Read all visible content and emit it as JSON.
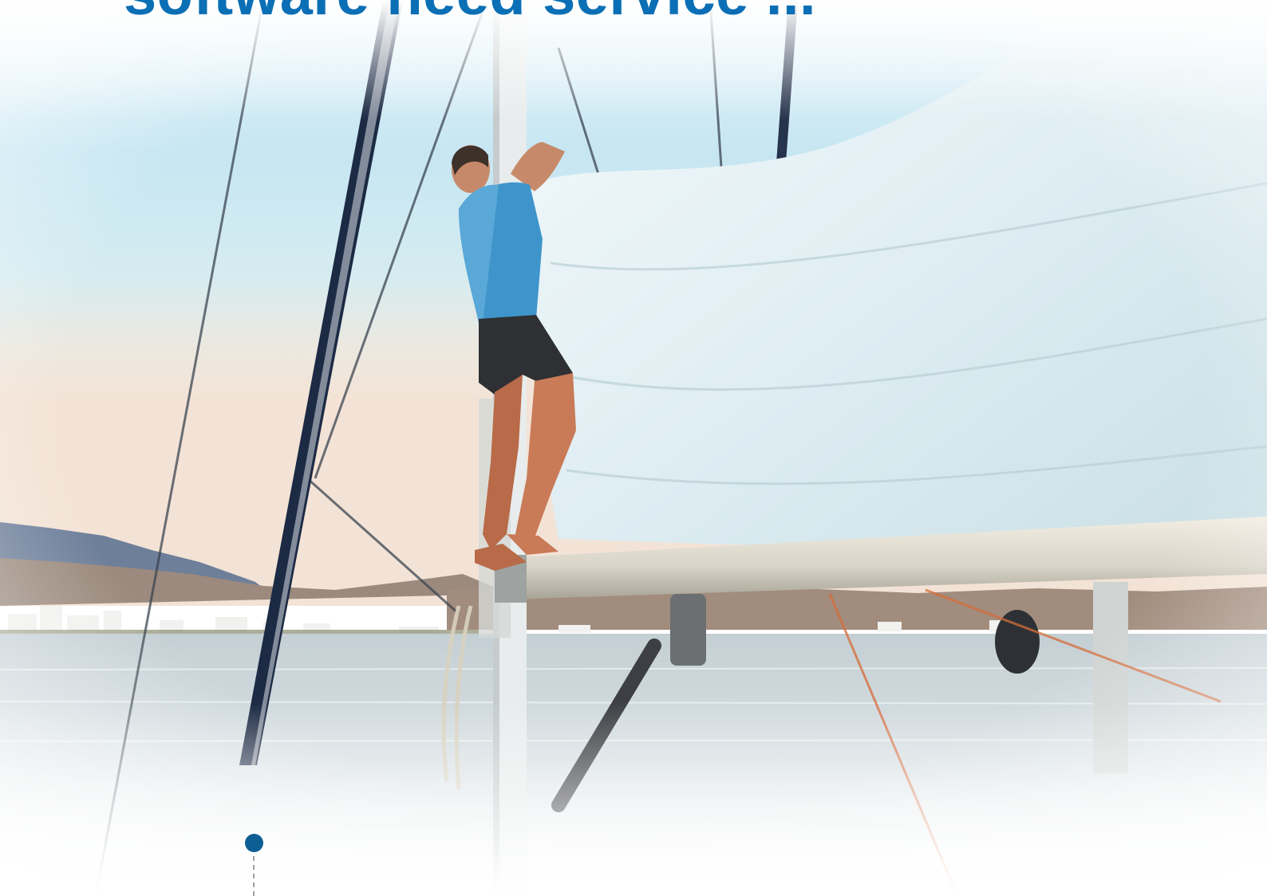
{
  "headline": {
    "text": "software need service ...",
    "color": "#0a6fb5"
  },
  "photo": {
    "subject": "sailor-on-boom-icon"
  },
  "timeline": {
    "dot_color": "#0d5f93"
  }
}
